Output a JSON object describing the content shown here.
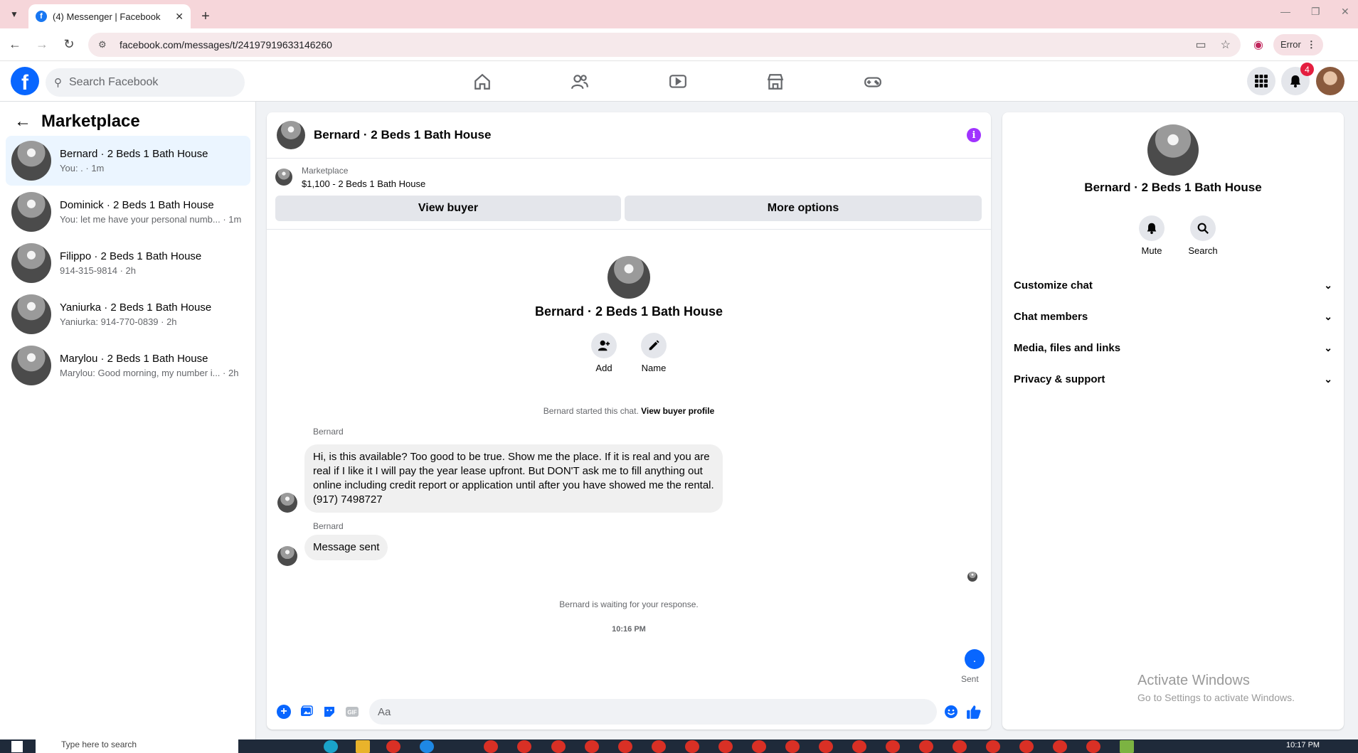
{
  "browser": {
    "tab_title": "(4) Messenger | Facebook",
    "tab_favicon": "f",
    "url": "facebook.com/messages/t/24197919633146260",
    "error_label": "Error"
  },
  "fb": {
    "search_placeholder": "Search Facebook",
    "notification_count": "4"
  },
  "left": {
    "title": "Marketplace",
    "conversations": [
      {
        "name": "Bernard · 2 Beds 1 Bath House",
        "sub": "You: . · 1m"
      },
      {
        "name": "Dominick · 2 Beds 1 Bath House",
        "sub": "You: let me have your personal numb... · 1m"
      },
      {
        "name": "Filippo · 2 Beds 1 Bath House",
        "sub": "914-315-9814 · 2h"
      },
      {
        "name": "Yaniurka · 2 Beds 1 Bath House",
        "sub": "Yaniurka: 914-770-0839 · 2h"
      },
      {
        "name": "Marylou · 2 Beds 1 Bath House",
        "sub": "Marylou: Good morning, my number i... · 2h"
      }
    ]
  },
  "chat": {
    "header_name": "Bernard · 2 Beds 1 Bath House",
    "listing_category": "Marketplace",
    "listing_price": "$1,100 - 2 Beds 1 Bath House",
    "view_buyer": "View buyer",
    "more_options": "More options",
    "intro_name": "Bernard · 2 Beds 1 Bath House",
    "add_label": "Add",
    "name_label": "Name",
    "started_text": "Bernard started this chat.",
    "view_profile": "View buyer profile",
    "messages": [
      {
        "sender": "Bernard",
        "text": "Hi, is this available? Too good to be true.  Show me the place.  If it is real and you are real if I like it I will pay the year lease upfront.  But DON'T ask me to fill anything out online including credit report or application until after you have showed me the rental.  (917) 7498727"
      },
      {
        "sender": "Bernard",
        "text": "Message sent"
      }
    ],
    "waiting_text": "Bernard is waiting for your response.",
    "time_text": "10:16 PM",
    "sent_bubble": ".",
    "sent_label": "Sent",
    "input_placeholder": "Aa"
  },
  "details": {
    "name": "Bernard · 2 Beds 1 Bath House",
    "mute_label": "Mute",
    "search_label": "Search",
    "sections": [
      "Customize chat",
      "Chat members",
      "Media, files and links",
      "Privacy & support"
    ]
  },
  "watermark": {
    "line1": "Activate Windows",
    "line2": "Go to Settings to activate Windows."
  },
  "taskbar": {
    "search_placeholder": "Type here to search",
    "clock": "10:17 PM"
  },
  "colors": {
    "brand_blue": "#0866ff",
    "active_row": "#ebf5ff",
    "info_purple": "#a033ff",
    "badge_red": "#e41e3f"
  }
}
